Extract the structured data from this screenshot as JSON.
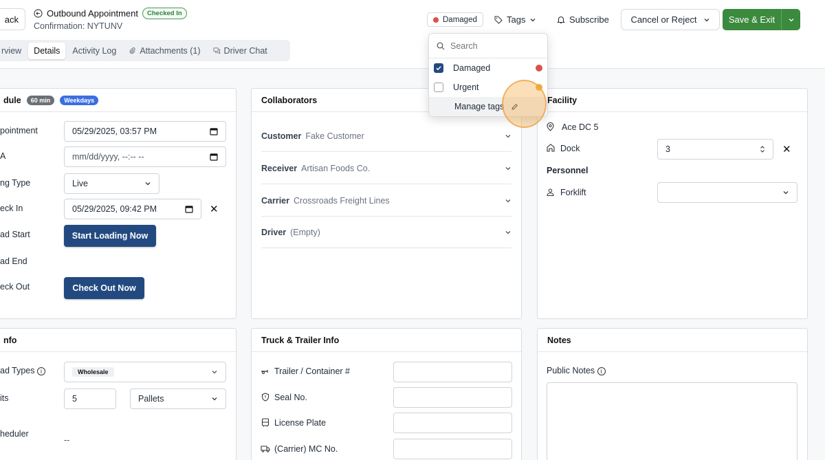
{
  "header": {
    "back_label": "ack",
    "title": "Outbound Appointment",
    "status": "Checked In",
    "confirmation": "Confirmation: NYTUNV",
    "tabs": [
      "rview",
      "Details",
      "Activity Log",
      "Attachments (1)",
      "Driver Chat"
    ],
    "active_tab": "Details",
    "applied_tag": "Damaged",
    "tags_label": "Tags",
    "subscribe_label": "Subscribe",
    "cancel_label": "Cancel or Reject",
    "save_label": "Save & Exit"
  },
  "schedule": {
    "title": "dule",
    "duration_badge": "60 min",
    "days_badge": "Weekdays",
    "rows": {
      "appointment_label": "pointment",
      "appointment_value": "05/29/2025, 03:57 PM",
      "eta_label": "A",
      "eta_value": "mm/dd/yyyy, --:-- --",
      "loading_type_label": "ng Type",
      "loading_type_value": "Live",
      "check_in_label": "eck In",
      "check_in_value": "05/29/2025, 09:42 PM",
      "load_start_label": "ad Start",
      "start_loading_button": "Start Loading Now",
      "load_end_label": "ad End",
      "check_out_label": "eck Out",
      "check_out_button": "Check Out Now"
    }
  },
  "collaborators": {
    "title": "Collaborators",
    "rows": [
      {
        "key": "Customer",
        "value": "Fake Customer"
      },
      {
        "key": "Receiver",
        "value": "Artisan Foods Co."
      },
      {
        "key": "Carrier",
        "value": "Crossroads Freight Lines"
      },
      {
        "key": "Driver",
        "value": "(Empty)"
      }
    ]
  },
  "facility": {
    "title": "Facility",
    "name": "Ace DC 5",
    "dock_label": "Dock",
    "dock_value": "3",
    "personnel_title": "Personnel",
    "forklift_label": "Forklift",
    "forklift_value": ""
  },
  "load_info": {
    "title": "nfo",
    "load_types_label": "ad Types",
    "load_types_value": "Wholesale",
    "units_label": "its",
    "units_value": "5",
    "unit_type": "Pallets",
    "scheduler_label": "heduler",
    "scheduler_value": "--"
  },
  "truck_trailer": {
    "title": "Truck & Trailer Info",
    "fields": [
      "Trailer / Container #",
      "Seal No.",
      "License Plate",
      "(Carrier) MC No."
    ]
  },
  "notes": {
    "title": "Notes",
    "public_notes_label": "Public Notes"
  },
  "tags_dropdown": {
    "search_placeholder": "Search",
    "options": [
      {
        "label": "Damaged",
        "checked": true,
        "color": "#d9534a"
      },
      {
        "label": "Urgent",
        "checked": false,
        "color": "#e8b23a"
      }
    ],
    "manage_label": "Manage tags"
  },
  "colors": {
    "save_green": "#3b8a3e",
    "navy": "#234a80",
    "damaged_red": "#d9534a",
    "urgent_yellow": "#e8b23a"
  }
}
